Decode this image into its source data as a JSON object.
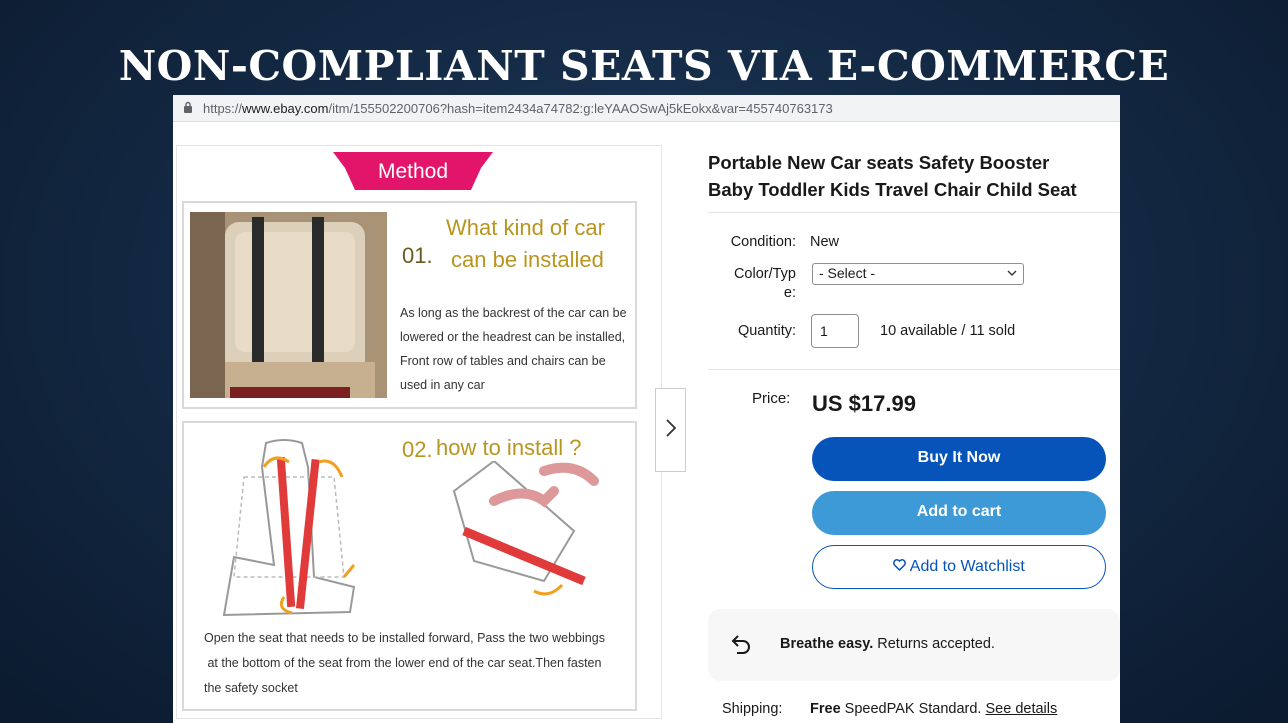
{
  "slide": {
    "title": "NON-COMPLIANT SEATS VIA E-COMMERCE"
  },
  "browser": {
    "url_prefix": "https://",
    "url_host": "www.ebay.com",
    "url_path": "/itm/155502200706?hash=item2434a74782:g:leYAAOSwAj5kEokx&var=455740763173"
  },
  "gallery": {
    "banner": "Method",
    "step1": {
      "number": "01.",
      "title_line1": "What kind of car",
      "title_line2": "can be installed",
      "desc_lines": [
        "As long as the backrest of the car can be",
        "lowered or the headrest can be installed,",
        "Front row of tables and chairs can be",
        "used in any car"
      ]
    },
    "step2": {
      "number": "02.",
      "title": "how to install ?",
      "desc_lines": [
        "Open the seat that needs to be installed forward, Pass the two webbings",
        " at the bottom of the seat from the lower end of the car seat.Then fasten",
        "the safety socket"
      ]
    },
    "next_icon": "chevron-right-icon"
  },
  "product": {
    "title_line1": "Portable New Car seats Safety Booster",
    "title_line2": "Baby Toddler Kids Travel Chair Child Seat",
    "condition_label": "Condition:",
    "condition_value": "New",
    "color_label_line1": "Color/Typ",
    "color_label_line2": "e:",
    "color_select": "- Select -",
    "quantity_label": "Quantity:",
    "quantity_value": "1",
    "availability": "10 available / 11 sold",
    "price_label": "Price:",
    "price": "US $17.99",
    "buy_now": "Buy It Now",
    "add_to_cart": "Add to cart",
    "watchlist": "Add to Watchlist",
    "returns_bold": "Breathe easy.",
    "returns_text": " Returns accepted.",
    "shipping_label": "Shipping:",
    "shipping_bold": "Free",
    "shipping_text": " SpeedPAK Standard. ",
    "shipping_link": "See details"
  },
  "colors": {
    "buy_now": "#0654ba",
    "add_to_cart": "#3d9ad6",
    "banner": "#e2156b",
    "accent_gold": "#b8951f"
  }
}
